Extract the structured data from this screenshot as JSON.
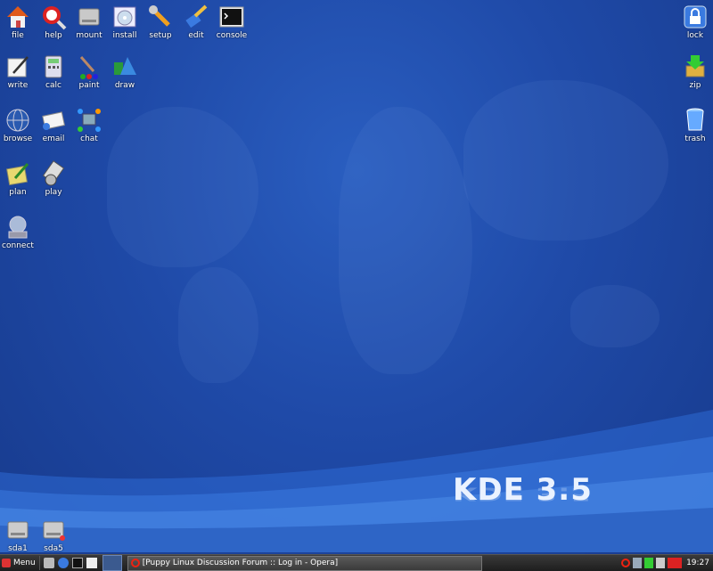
{
  "desktop": {
    "top_left": [
      "file",
      "help",
      "mount",
      "install",
      "setup",
      "edit",
      "console"
    ],
    "row2": [
      "write",
      "calc",
      "paint",
      "draw"
    ],
    "row3": [
      "browse",
      "email",
      "chat"
    ],
    "row4": [
      "plan",
      "play"
    ],
    "row5": [
      "connect"
    ],
    "right": [
      "lock",
      "zip",
      "trash"
    ],
    "drives": [
      "sda1",
      "sda5"
    ],
    "logo": "KDE 3.5"
  },
  "taskbar": {
    "menu_label": "Menu",
    "task_title": "[Puppy Linux Discussion Forum :: Log in - Opera]",
    "clock": "19:27"
  },
  "colors": {
    "desktop_bg": "#1f4aa8",
    "taskbar_bg": "#2a2a2a"
  }
}
